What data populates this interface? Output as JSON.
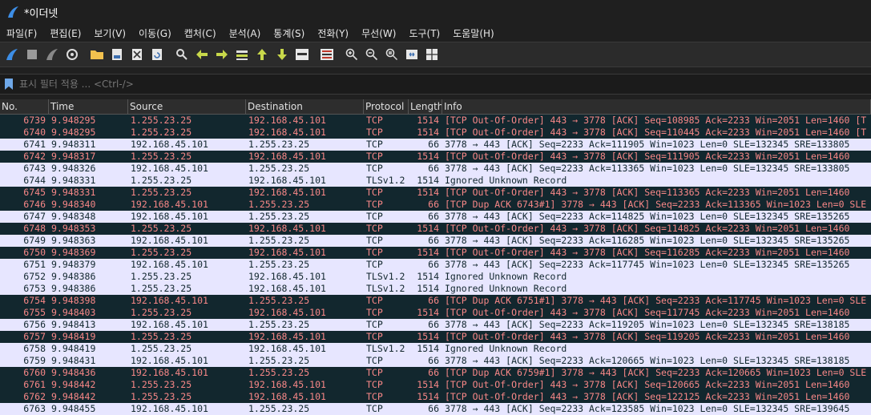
{
  "window": {
    "title": "*이더넷"
  },
  "menu": [
    "파일(F)",
    "편집(E)",
    "보기(V)",
    "이동(G)",
    "캡처(C)",
    "분석(A)",
    "통계(S)",
    "전화(Y)",
    "무선(W)",
    "도구(T)",
    "도움말(H)"
  ],
  "toolbar_icons": [
    "shark-fin-start-icon",
    "stop-icon",
    "restart-icon",
    "options-gear-icon",
    "open-folder-icon",
    "save-file-icon",
    "close-file-icon",
    "reload-icon",
    "find-icon",
    "go-back-icon",
    "go-forward-icon",
    "go-to-packet-icon",
    "go-first-icon",
    "go-last-icon",
    "autoscroll-icon",
    "colorize-icon",
    "zoom-in-icon",
    "zoom-out-icon",
    "zoom-normal-icon",
    "resize-columns-icon",
    "layout-icon"
  ],
  "filter": {
    "placeholder": "표시 필터 적용 ... <Ctrl-/>"
  },
  "columns": [
    "No.",
    "Time",
    "Source",
    "Destination",
    "Protocol",
    "Length",
    "Info"
  ],
  "packets": [
    {
      "no": "6739",
      "time": "9.948295",
      "src": "1.255.23.25",
      "dst": "192.168.45.101",
      "proto": "TCP",
      "len": "1514",
      "info": "[TCP Out-Of-Order] 443 → 3778 [ACK] Seq=108985 Ack=2233 Win=2051 Len=1460 [T",
      "style": "bad"
    },
    {
      "no": "6740",
      "time": "9.948295",
      "src": "1.255.23.25",
      "dst": "192.168.45.101",
      "proto": "TCP",
      "len": "1514",
      "info": "[TCP Out-Of-Order] 443 → 3778 [ACK] Seq=110445 Ack=2233 Win=2051 Len=1460 [T",
      "style": "bad"
    },
    {
      "no": "6741",
      "time": "9.948311",
      "src": "192.168.45.101",
      "dst": "1.255.23.25",
      "proto": "TCP",
      "len": "66",
      "info": "3778 → 443 [ACK] Seq=2233 Ack=111905 Win=1023 Len=0 SLE=132345 SRE=133805",
      "style": "normal"
    },
    {
      "no": "6742",
      "time": "9.948317",
      "src": "1.255.23.25",
      "dst": "192.168.45.101",
      "proto": "TCP",
      "len": "1514",
      "info": "[TCP Out-Of-Order] 443 → 3778 [ACK] Seq=111905 Ack=2233 Win=2051 Len=1460",
      "style": "bad"
    },
    {
      "no": "6743",
      "time": "9.948326",
      "src": "192.168.45.101",
      "dst": "1.255.23.25",
      "proto": "TCP",
      "len": "66",
      "info": "3778 → 443 [ACK] Seq=2233 Ack=113365 Win=1023 Len=0 SLE=132345 SRE=133805",
      "style": "normal"
    },
    {
      "no": "6744",
      "time": "9.948331",
      "src": "1.255.23.25",
      "dst": "192.168.45.101",
      "proto": "TLSv1.2",
      "len": "1514",
      "info": "Ignored Unknown Record",
      "style": "normal"
    },
    {
      "no": "6745",
      "time": "9.948331",
      "src": "1.255.23.25",
      "dst": "192.168.45.101",
      "proto": "TCP",
      "len": "1514",
      "info": "[TCP Out-Of-Order] 443 → 3778 [ACK] Seq=113365 Ack=2233 Win=2051 Len=1460",
      "style": "bad"
    },
    {
      "no": "6746",
      "time": "9.948340",
      "src": "192.168.45.101",
      "dst": "1.255.23.25",
      "proto": "TCP",
      "len": "66",
      "info": "[TCP Dup ACK 6743#1] 3778 → 443 [ACK] Seq=2233 Ack=113365 Win=1023 Len=0 SLE",
      "style": "bad"
    },
    {
      "no": "6747",
      "time": "9.948348",
      "src": "192.168.45.101",
      "dst": "1.255.23.25",
      "proto": "TCP",
      "len": "66",
      "info": "3778 → 443 [ACK] Seq=2233 Ack=114825 Win=1023 Len=0 SLE=132345 SRE=135265",
      "style": "normal"
    },
    {
      "no": "6748",
      "time": "9.948353",
      "src": "1.255.23.25",
      "dst": "192.168.45.101",
      "proto": "TCP",
      "len": "1514",
      "info": "[TCP Out-Of-Order] 443 → 3778 [ACK] Seq=114825 Ack=2233 Win=2051 Len=1460",
      "style": "bad"
    },
    {
      "no": "6749",
      "time": "9.948363",
      "src": "192.168.45.101",
      "dst": "1.255.23.25",
      "proto": "TCP",
      "len": "66",
      "info": "3778 → 443 [ACK] Seq=2233 Ack=116285 Win=1023 Len=0 SLE=132345 SRE=135265",
      "style": "normal"
    },
    {
      "no": "6750",
      "time": "9.948369",
      "src": "1.255.23.25",
      "dst": "192.168.45.101",
      "proto": "TCP",
      "len": "1514",
      "info": "[TCP Out-Of-Order] 443 → 3778 [ACK] Seq=116285 Ack=2233 Win=2051 Len=1460",
      "style": "bad"
    },
    {
      "no": "6751",
      "time": "9.948379",
      "src": "192.168.45.101",
      "dst": "1.255.23.25",
      "proto": "TCP",
      "len": "66",
      "info": "3778 → 443 [ACK] Seq=2233 Ack=117745 Win=1023 Len=0 SLE=132345 SRE=135265",
      "style": "normal"
    },
    {
      "no": "6752",
      "time": "9.948386",
      "src": "1.255.23.25",
      "dst": "192.168.45.101",
      "proto": "TLSv1.2",
      "len": "1514",
      "info": "Ignored Unknown Record",
      "style": "normal"
    },
    {
      "no": "6753",
      "time": "9.948386",
      "src": "1.255.23.25",
      "dst": "192.168.45.101",
      "proto": "TLSv1.2",
      "len": "1514",
      "info": "Ignored Unknown Record",
      "style": "normal"
    },
    {
      "no": "6754",
      "time": "9.948398",
      "src": "192.168.45.101",
      "dst": "1.255.23.25",
      "proto": "TCP",
      "len": "66",
      "info": "[TCP Dup ACK 6751#1] 3778 → 443 [ACK] Seq=2233 Ack=117745 Win=1023 Len=0 SLE",
      "style": "bad"
    },
    {
      "no": "6755",
      "time": "9.948403",
      "src": "1.255.23.25",
      "dst": "192.168.45.101",
      "proto": "TCP",
      "len": "1514",
      "info": "[TCP Out-Of-Order] 443 → 3778 [ACK] Seq=117745 Ack=2233 Win=2051 Len=1460",
      "style": "bad"
    },
    {
      "no": "6756",
      "time": "9.948413",
      "src": "192.168.45.101",
      "dst": "1.255.23.25",
      "proto": "TCP",
      "len": "66",
      "info": "3778 → 443 [ACK] Seq=2233 Ack=119205 Win=1023 Len=0 SLE=132345 SRE=138185",
      "style": "normal"
    },
    {
      "no": "6757",
      "time": "9.948419",
      "src": "1.255.23.25",
      "dst": "192.168.45.101",
      "proto": "TCP",
      "len": "1514",
      "info": "[TCP Out-Of-Order] 443 → 3778 [ACK] Seq=119205 Ack=2233 Win=2051 Len=1460",
      "style": "bad"
    },
    {
      "no": "6758",
      "time": "9.948419",
      "src": "1.255.23.25",
      "dst": "192.168.45.101",
      "proto": "TLSv1.2",
      "len": "1514",
      "info": "Ignored Unknown Record",
      "style": "normal"
    },
    {
      "no": "6759",
      "time": "9.948431",
      "src": "192.168.45.101",
      "dst": "1.255.23.25",
      "proto": "TCP",
      "len": "66",
      "info": "3778 → 443 [ACK] Seq=2233 Ack=120665 Win=1023 Len=0 SLE=132345 SRE=138185",
      "style": "normal"
    },
    {
      "no": "6760",
      "time": "9.948436",
      "src": "192.168.45.101",
      "dst": "1.255.23.25",
      "proto": "TCP",
      "len": "66",
      "info": "[TCP Dup ACK 6759#1] 3778 → 443 [ACK] Seq=2233 Ack=120665 Win=1023 Len=0 SLE",
      "style": "bad"
    },
    {
      "no": "6761",
      "time": "9.948442",
      "src": "1.255.23.25",
      "dst": "192.168.45.101",
      "proto": "TCP",
      "len": "1514",
      "info": "[TCP Out-Of-Order] 443 → 3778 [ACK] Seq=120665 Ack=2233 Win=2051 Len=1460",
      "style": "bad"
    },
    {
      "no": "6762",
      "time": "9.948442",
      "src": "1.255.23.25",
      "dst": "192.168.45.101",
      "proto": "TCP",
      "len": "1514",
      "info": "[TCP Out-Of-Order] 443 → 3778 [ACK] Seq=122125 Ack=2233 Win=2051 Len=1460",
      "style": "bad"
    },
    {
      "no": "6763",
      "time": "9.948455",
      "src": "192.168.45.101",
      "dst": "1.255.23.25",
      "proto": "TCP",
      "len": "66",
      "info": "3778 → 443 [ACK] Seq=2233 Ack=123585 Win=1023 Len=0 SLE=132345 SRE=139645",
      "style": "normal"
    }
  ]
}
